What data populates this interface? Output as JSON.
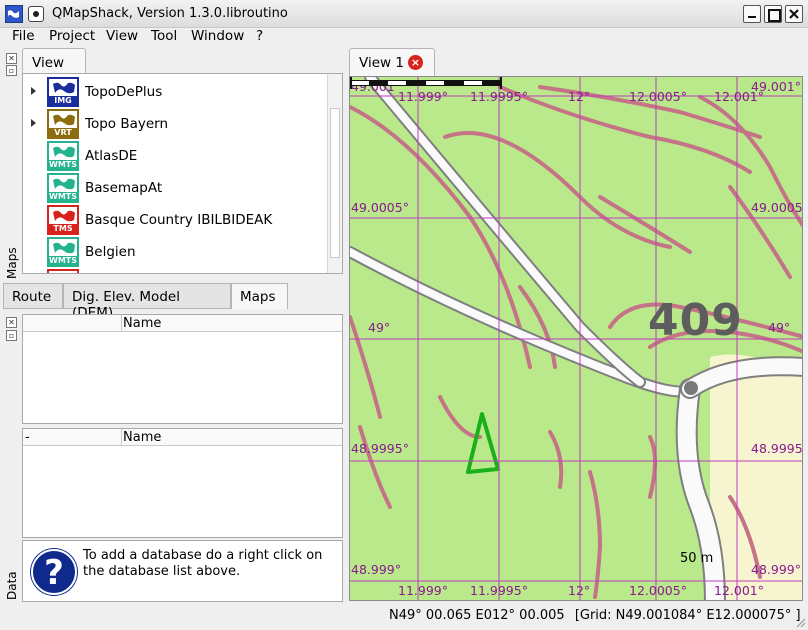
{
  "window": {
    "title": "QMapShack, Version 1.3.0.libroutino"
  },
  "menu": [
    "File",
    "Project",
    "View",
    "Tool",
    "Window",
    "?"
  ],
  "left_panel": {
    "dock_label_maps": "Maps",
    "dock_label_data": "Data",
    "maps_tab": "View 1",
    "maps": [
      {
        "name": "TopoDePlus",
        "type": "IMG",
        "color": "#1a2d9c",
        "expandable": true
      },
      {
        "name": "Topo Bayern",
        "type": "VRT",
        "color": "#8b6d10",
        "expandable": true
      },
      {
        "name": "AtlasDE",
        "type": "WMTS",
        "color": "#24b38e",
        "expandable": false
      },
      {
        "name": "BasemapAt",
        "type": "WMTS",
        "color": "#24b38e",
        "expandable": false
      },
      {
        "name": "Basque Country IBILBIDEAK",
        "type": "TMS",
        "color": "#d8231c",
        "expandable": false
      },
      {
        "name": "Belgien",
        "type": "WMTS",
        "color": "#24b38e",
        "expandable": false
      }
    ],
    "bottom_tabs": [
      "Route",
      "Dig. Elev. Model (DEM)",
      "Maps"
    ],
    "project_table": {
      "col_name": "Name"
    },
    "db_table": {
      "col_dash": "-",
      "col_name": "Name"
    },
    "help_text": "To add a database do a right click on the database list above."
  },
  "map_view": {
    "tab_label": "View 1",
    "elevation_label": "409",
    "grid_labels": {
      "lat": [
        "49.001°",
        "49.0005°",
        "49°",
        "48.9995°",
        "48.999°"
      ],
      "lon": [
        "11.999°",
        "11.9995°",
        "12°",
        "12.0005°",
        "12.001°"
      ]
    },
    "scale_label": "50 m"
  },
  "status": {
    "position": "N49° 00.065 E012° 00.005",
    "grid": "[Grid: N49.001084° E12.000075° ]"
  }
}
